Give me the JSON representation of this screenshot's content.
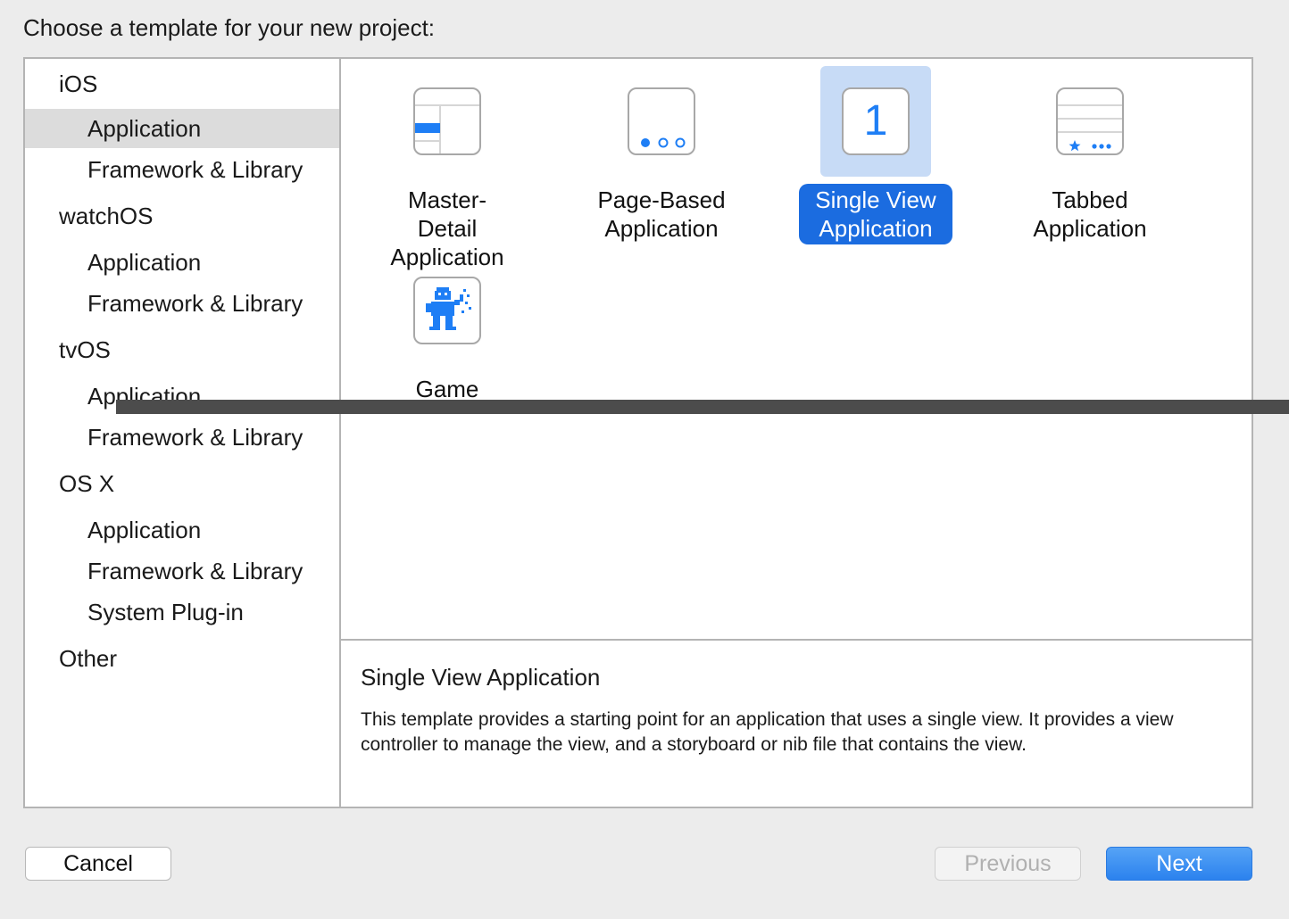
{
  "dialog": {
    "heading": "Choose a template for your new project:"
  },
  "sidebar": {
    "items": [
      {
        "label": "iOS",
        "level": "platform",
        "selected": false
      },
      {
        "label": "Application",
        "level": "category",
        "selected": true
      },
      {
        "label": "Framework & Library",
        "level": "category",
        "selected": false
      },
      {
        "label": "watchOS",
        "level": "platform",
        "selected": false
      },
      {
        "label": "Application",
        "level": "category",
        "selected": false
      },
      {
        "label": "Framework & Library",
        "level": "category",
        "selected": false
      },
      {
        "label": "tvOS",
        "level": "platform",
        "selected": false
      },
      {
        "label": "Application",
        "level": "category",
        "selected": false
      },
      {
        "label": "Framework & Library",
        "level": "category",
        "selected": false
      },
      {
        "label": "OS X",
        "level": "platform",
        "selected": false
      },
      {
        "label": "Application",
        "level": "category",
        "selected": false
      },
      {
        "label": "Framework & Library",
        "level": "category",
        "selected": false
      },
      {
        "label": "System Plug-in",
        "level": "category",
        "selected": false
      },
      {
        "label": "Other",
        "level": "platform",
        "selected": false
      }
    ]
  },
  "templates": [
    {
      "line1": "Master-Detail",
      "line2": "Application",
      "icon": "master-detail-icon",
      "selected": false
    },
    {
      "line1": "Page-Based",
      "line2": "Application",
      "icon": "page-based-icon",
      "selected": false
    },
    {
      "line1": "Single View",
      "line2": "Application",
      "icon": "single-view-icon",
      "icon_text": "1",
      "selected": true
    },
    {
      "line1": "Tabbed",
      "line2": "Application",
      "icon": "tabbed-icon",
      "selected": false
    },
    {
      "line1": "Game",
      "line2": "",
      "icon": "game-icon",
      "selected": false
    }
  ],
  "description": {
    "title": "Single View Application",
    "text": "This template provides a starting point for an application that uses a single view. It provides a view controller to manage the view, and a storyboard or nib file that contains the view."
  },
  "buttons": {
    "cancel": "Cancel",
    "previous": "Previous",
    "next": "Next"
  },
  "colors": {
    "accent": "#1b6ce0",
    "icon_blue": "#1e7ef5",
    "selection_bg": "#c7dbf6",
    "sidebar_selected": "#dcdcdc"
  }
}
